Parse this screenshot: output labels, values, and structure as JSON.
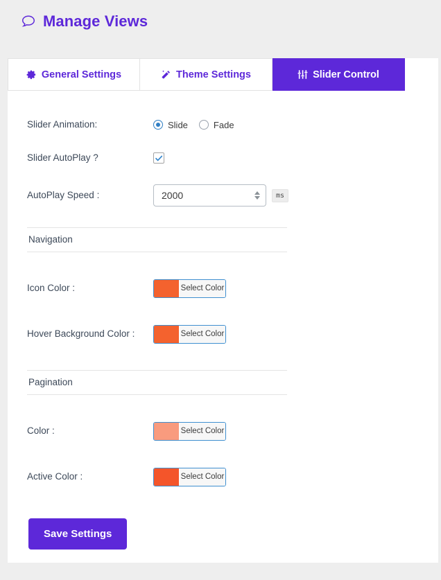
{
  "header": {
    "icon": "comment-bubble-icon",
    "title": "Manage Views",
    "accent_color": "#5d28d9"
  },
  "tabs": [
    {
      "label": "General Settings",
      "icon": "gear-icon",
      "active": false
    },
    {
      "label": "Theme Settings",
      "icon": "magic-wand-icon",
      "active": false
    },
    {
      "label": "Slider Control",
      "icon": "sliders-icon",
      "active": true
    }
  ],
  "form": {
    "animation": {
      "label": "Slider Animation:",
      "options": [
        {
          "label": "Slide",
          "checked": true
        },
        {
          "label": "Fade",
          "checked": false
        }
      ]
    },
    "autoplay": {
      "label": "Slider AutoPlay ?",
      "checked": true
    },
    "autoplay_speed": {
      "label": "AutoPlay Speed :",
      "value": "2000",
      "unit": "ms"
    },
    "sections": [
      {
        "title": "Navigation",
        "fields": [
          {
            "label": "Icon Color :",
            "button_label": "Select Color",
            "color": "#f4622e"
          },
          {
            "label": "Hover Background Color :",
            "button_label": "Select Color",
            "color": "#f4622e"
          }
        ]
      },
      {
        "title": "Pagination",
        "fields": [
          {
            "label": "Color :",
            "button_label": "Select Color",
            "color": "#f99b7e"
          },
          {
            "label": "Active Color :",
            "button_label": "Select Color",
            "color": "#f4552a"
          }
        ]
      }
    ],
    "save_label": "Save Settings"
  }
}
